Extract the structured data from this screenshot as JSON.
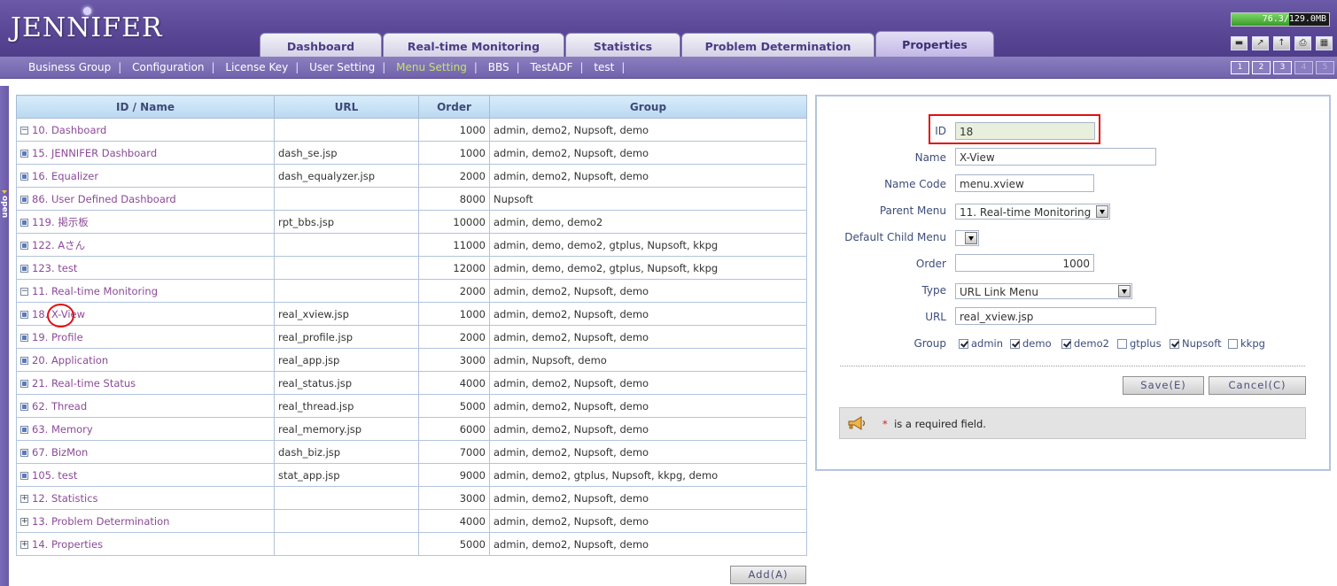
{
  "app": {
    "logo": "JENNIFER",
    "memory": {
      "text": "76.3/129.0MB",
      "used_fraction": 0.59
    }
  },
  "tabs": [
    {
      "label": "Dashboard",
      "active": false
    },
    {
      "label": "Real-time Monitoring",
      "active": false
    },
    {
      "label": "Statistics",
      "active": false
    },
    {
      "label": "Problem Determination",
      "active": false
    },
    {
      "label": "Properties",
      "active": true
    }
  ],
  "submenu": [
    {
      "label": "Business Group",
      "active": false
    },
    {
      "label": "Configuration",
      "active": false
    },
    {
      "label": "License Key",
      "active": false
    },
    {
      "label": "User Setting",
      "active": false
    },
    {
      "label": "Menu Setting",
      "active": true
    },
    {
      "label": "BBS",
      "active": false
    },
    {
      "label": "TestADF",
      "active": false
    },
    {
      "label": "test",
      "active": false
    }
  ],
  "pages": [
    "1",
    "2",
    "3",
    "4",
    "5"
  ],
  "sidetab": {
    "label": "open"
  },
  "table": {
    "columns": [
      "ID / Name",
      "URL",
      "Order",
      "Group"
    ],
    "rows": [
      {
        "level": 0,
        "expanded": true,
        "name": "10. Dashboard",
        "url": "",
        "order": "1000",
        "group": "admin, demo2, Nupsoft, demo"
      },
      {
        "level": 1,
        "leaf": true,
        "name": "15. JENNIFER Dashboard",
        "url": "dash_se.jsp",
        "order": "1000",
        "group": "admin, demo2, Nupsoft, demo"
      },
      {
        "level": 1,
        "leaf": true,
        "name": "16. Equalizer",
        "url": "dash_equalyzer.jsp",
        "order": "2000",
        "group": "admin, demo2, Nupsoft, demo"
      },
      {
        "level": 1,
        "leaf": true,
        "name": "86. User Defined Dashboard",
        "url": "",
        "order": "8000",
        "group": "Nupsoft"
      },
      {
        "level": 1,
        "leaf": true,
        "name": "119. 掲示板",
        "url": "rpt_bbs.jsp",
        "order": "10000",
        "group": "admin, demo, demo2"
      },
      {
        "level": 1,
        "leaf": true,
        "name": "122. Aさん",
        "url": "",
        "order": "11000",
        "group": "admin, demo, demo2, gtplus, Nupsoft, kkpg"
      },
      {
        "level": 1,
        "leaf": true,
        "name": "123. test",
        "url": "",
        "order": "12000",
        "group": "admin, demo, demo2, gtplus, Nupsoft, kkpg"
      },
      {
        "level": 0,
        "expanded": true,
        "name": "11. Real-time Monitoring",
        "url": "",
        "order": "2000",
        "group": "admin, demo2, Nupsoft, demo"
      },
      {
        "level": 1,
        "leaf": true,
        "name": "18. X-View",
        "url": "real_xview.jsp",
        "order": "1000",
        "group": "admin, demo2, Nupsoft, demo"
      },
      {
        "level": 1,
        "leaf": true,
        "name": "19. Profile",
        "url": "real_profile.jsp",
        "order": "2000",
        "group": "admin, demo2, Nupsoft, demo"
      },
      {
        "level": 1,
        "leaf": true,
        "name": "20. Application",
        "url": "real_app.jsp",
        "order": "3000",
        "group": "admin, Nupsoft, demo"
      },
      {
        "level": 1,
        "leaf": true,
        "name": "21. Real-time Status",
        "url": "real_status.jsp",
        "order": "4000",
        "group": "admin, demo2, Nupsoft, demo"
      },
      {
        "level": 1,
        "leaf": true,
        "name": "62. Thread",
        "url": "real_thread.jsp",
        "order": "5000",
        "group": "admin, demo2, Nupsoft, demo"
      },
      {
        "level": 1,
        "leaf": true,
        "name": "63. Memory",
        "url": "real_memory.jsp",
        "order": "6000",
        "group": "admin, demo2, Nupsoft, demo"
      },
      {
        "level": 1,
        "leaf": true,
        "name": "67. BizMon",
        "url": "dash_biz.jsp",
        "order": "7000",
        "group": "admin, demo2, Nupsoft, demo"
      },
      {
        "level": 1,
        "leaf": true,
        "name": "105. test",
        "url": "stat_app.jsp",
        "order": "9000",
        "group": "admin, demo2, gtplus, Nupsoft, kkpg, demo"
      },
      {
        "level": 0,
        "expanded": false,
        "name": "12. Statistics",
        "url": "",
        "order": "3000",
        "group": "admin, demo2, Nupsoft, demo"
      },
      {
        "level": 0,
        "expanded": false,
        "name": "13. Problem Determination",
        "url": "",
        "order": "4000",
        "group": "admin, demo2, Nupsoft, demo"
      },
      {
        "level": 0,
        "expanded": false,
        "name": "14. Properties",
        "url": "",
        "order": "5000",
        "group": "admin, demo2, Nupsoft, demo"
      }
    ],
    "add_button": "Add(A)"
  },
  "form": {
    "id": {
      "label": "ID",
      "value": "18"
    },
    "name": {
      "label": "Name",
      "value": "X-View"
    },
    "name_code": {
      "label": "Name Code",
      "value": "menu.xview"
    },
    "parent_menu": {
      "label": "Parent Menu",
      "value": "11. Real-time Monitoring"
    },
    "default_child_menu": {
      "label": "Default Child Menu",
      "value": ""
    },
    "order": {
      "label": "Order",
      "value": "1000"
    },
    "type": {
      "label": "Type",
      "value": "URL Link Menu"
    },
    "url": {
      "label": "URL",
      "value": "real_xview.jsp"
    },
    "group": {
      "label": "Group",
      "options": [
        {
          "label": "admin",
          "checked": true
        },
        {
          "label": "demo",
          "checked": true
        },
        {
          "label": "demo2",
          "checked": true
        },
        {
          "label": "gtplus",
          "checked": false
        },
        {
          "label": "Nupsoft",
          "checked": true
        },
        {
          "label": "kkpg",
          "checked": false
        }
      ]
    },
    "save_button": "Save(E)",
    "cancel_button": "Cancel(C)",
    "required_star": "*",
    "required_note": "is a required field."
  },
  "colors": {
    "header": "#5a4896",
    "link": "#8b4a97",
    "active_submenu": "#c3e46a",
    "highlight": "#e01010"
  }
}
